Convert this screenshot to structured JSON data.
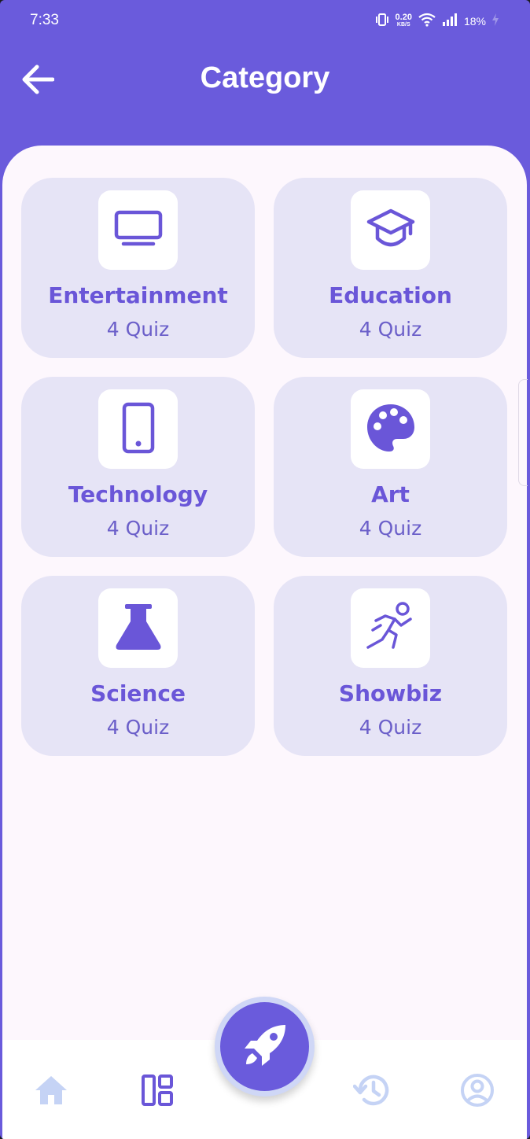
{
  "status_bar": {
    "time": "7:33",
    "network_speed": "0.20",
    "network_unit": "KB/S",
    "battery": "18%"
  },
  "header": {
    "title": "Category",
    "back_icon": "arrow-left-icon"
  },
  "categories": [
    {
      "name": "Entertainment",
      "count": "4 Quiz",
      "icon": "tv-icon"
    },
    {
      "name": "Education",
      "count": "4 Quiz",
      "icon": "graduation-cap-icon"
    },
    {
      "name": "Technology",
      "count": "4 Quiz",
      "icon": "smartphone-icon"
    },
    {
      "name": "Art",
      "count": "4 Quiz",
      "icon": "palette-icon"
    },
    {
      "name": "Science",
      "count": "4 Quiz",
      "icon": "flask-icon"
    },
    {
      "name": "Showbiz",
      "count": "4 Quiz",
      "icon": "running-person-icon"
    }
  ],
  "bottom_nav": {
    "items": [
      {
        "icon": "home-icon",
        "active": false
      },
      {
        "icon": "dashboard-icon",
        "active": true
      },
      {
        "icon": "history-icon",
        "active": false
      },
      {
        "icon": "profile-icon",
        "active": false
      }
    ],
    "fab_icon": "rocket-icon"
  },
  "colors": {
    "primary": "#6a5bdc",
    "card_bg": "#e6e4f6",
    "content_bg": "#fdf7fd",
    "inactive_nav": "#c5d3f5"
  }
}
